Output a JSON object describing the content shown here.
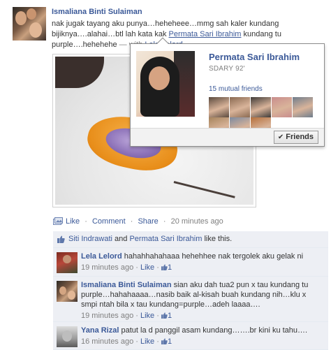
{
  "post": {
    "author": "Ismaliana Binti Sulaiman",
    "text_before": "nak jugak tayang aku punya…heheheee…mmg sah kaler kundang bijiknya….alahai…btl lah kata kak ",
    "tagged_link": "Permata Sari Ibrahim",
    "text_after": " kundang tu purple….hehehehe",
    "with_sep": " — with ",
    "with_name": "Lela Lelord",
    "with_suffix": "."
  },
  "actions": {
    "like": "Like",
    "dot1": " · ",
    "comment": "Comment",
    "dot2": " · ",
    "share": "Share",
    "dot3": " · ",
    "time": "20 minutes ago"
  },
  "likes_row": {
    "person1": "Siti Indrawati",
    "and": " and ",
    "person2": "Permata Sari Ibrahim",
    "suffix": " like this."
  },
  "comments": [
    {
      "author": "Lela Lelord",
      "text": "hahahhahahaaa hehehhee nak tergolek aku gelak ni",
      "time": "19 minutes ago",
      "like": "Like",
      "like_count": "1"
    },
    {
      "author": "Ismaliana Binti Sulaiman",
      "text": "sian aku dah tua2 pun x tau kundang tu purple…hahahaaaa…nasib baik al-kisah buah kundang nih…klu x smpi ntah bila x tau kundang=purple…adeh laaaa….",
      "time": "19 minutes ago",
      "like": "Like",
      "like_count": "1"
    },
    {
      "author": "Yana Rizal",
      "text": "patut la d panggil asam kundang…….br kini ku tahu….",
      "time": "16 minutes ago",
      "like": "Like",
      "like_count": "1"
    }
  ],
  "hovercard": {
    "name": "Permata Sari Ibrahim",
    "subtitle": "SDARY 92'",
    "mutual": "15 mutual friends",
    "button": "Friends",
    "thumb_colors": [
      "#5b4a3e",
      "#8a6a52",
      "#3f3b38",
      "#c98d8d",
      "#6f7d8c",
      "#a6845d",
      "#7c8aa0",
      "#b5703c"
    ]
  },
  "colors": {
    "link": "#3b5998",
    "ufi_bg": "#edeff4",
    "muted": "#808080"
  }
}
